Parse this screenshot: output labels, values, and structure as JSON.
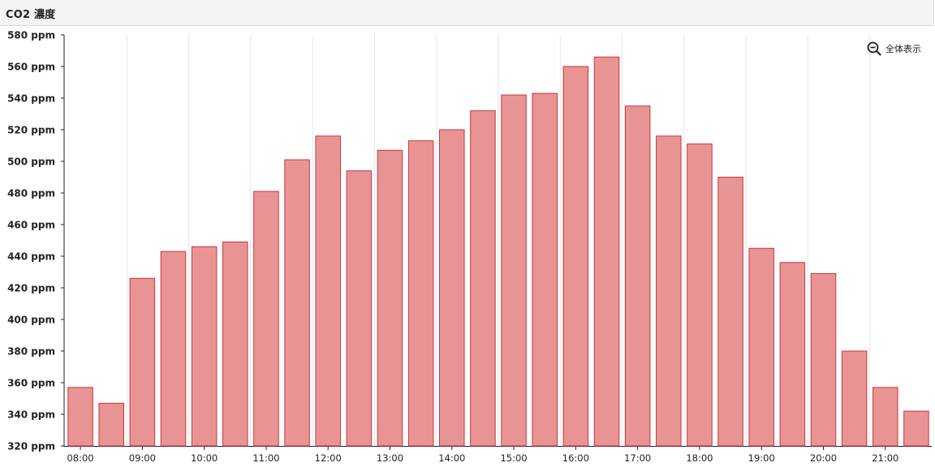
{
  "panel": {
    "title": "CO2 濃度"
  },
  "controls": {
    "reset_zoom_label": "全体表示",
    "reset_zoom_icon": "zoom-out-icon"
  },
  "colors": {
    "bar_fill": "#e99494",
    "bar_stroke": "#c9363b",
    "grid": "#e6e6e6",
    "axis": "#222222"
  },
  "chart_data": {
    "type": "bar",
    "title": "CO2 濃度",
    "xlabel": "",
    "ylabel": "",
    "unit": "ppm",
    "ylim": [
      320,
      580
    ],
    "ytick_step": 20,
    "yticks": [
      "320 ppm",
      "340 ppm",
      "360 ppm",
      "380 ppm",
      "400 ppm",
      "420 ppm",
      "440 ppm",
      "460 ppm",
      "480 ppm",
      "500 ppm",
      "520 ppm",
      "540 ppm",
      "560 ppm",
      "580 ppm"
    ],
    "xticks": [
      "08:00",
      "09:00",
      "10:00",
      "11:00",
      "12:00",
      "13:00",
      "14:00",
      "15:00",
      "16:00",
      "17:00",
      "18:00",
      "19:00",
      "20:00",
      "21:00"
    ],
    "x": [
      "08:00",
      "08:30",
      "09:00",
      "09:30",
      "10:00",
      "10:30",
      "11:00",
      "11:30",
      "12:00",
      "12:30",
      "13:00",
      "13:30",
      "14:00",
      "14:30",
      "15:00",
      "15:30",
      "16:00",
      "16:30",
      "17:00",
      "17:30",
      "18:00",
      "18:30",
      "19:00",
      "19:30",
      "20:00",
      "20:30",
      "21:00",
      "21:30"
    ],
    "values": [
      357,
      347,
      426,
      443,
      446,
      449,
      481,
      501,
      516,
      494,
      507,
      513,
      520,
      532,
      542,
      543,
      560,
      566,
      535,
      516,
      511,
      490,
      445,
      436,
      429,
      380,
      357,
      342
    ],
    "grid": true,
    "legend": "none"
  }
}
